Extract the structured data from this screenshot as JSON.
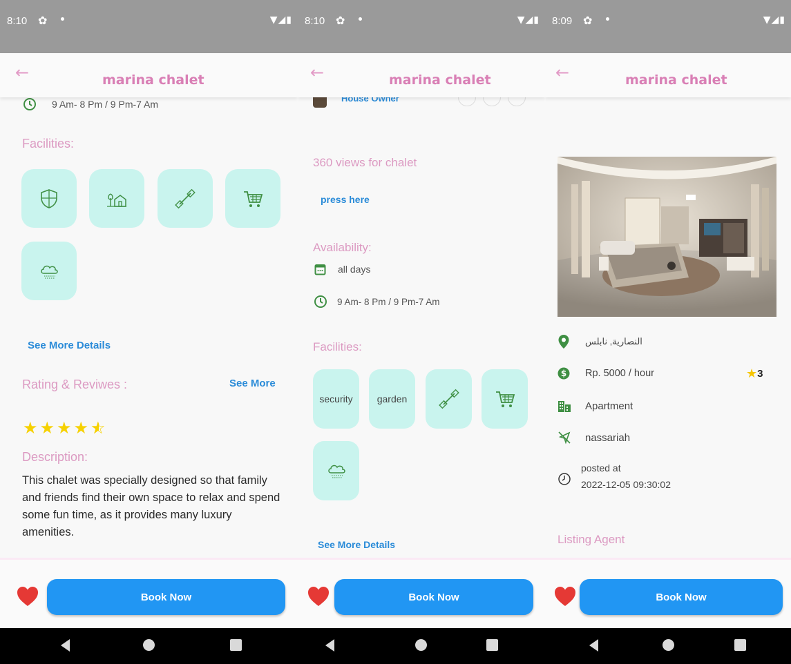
{
  "status": {
    "s1_time": "8:10",
    "s2_time": "8:10",
    "s3_time": "8:09"
  },
  "appbar_title": "marina chalet",
  "screen1": {
    "hours": "9 Am- 8 Pm / 9 Pm-7 Am",
    "facilities_heading": "Facilities:",
    "see_more_details": "See More Details",
    "rating_heading": "Rating & Reviwes :",
    "see_more": "See More",
    "rating_stars": 4.5,
    "description_heading": "Description:",
    "description": "This chalet was specially designed so that family and friends find their own space to relax and spend some fun time, as it provides many luxury amenities."
  },
  "screen2": {
    "owner_label": "House Owner",
    "views_heading": "360 views for chalet",
    "press_here": "press here",
    "availability_heading": "Availability:",
    "days": "all days",
    "hours": "9 Am- 8 Pm / 9 Pm-7 Am",
    "facilities_heading": "Facilities:",
    "facility_security": "security",
    "facility_garden": "garden",
    "see_more_details": "See More Details"
  },
  "screen3": {
    "location": "النصارية, نابلس",
    "price": "Rp. 5000 / hour",
    "rating": "3",
    "type": "Apartment",
    "area": "nassariah",
    "posted_label": "posted at",
    "posted_date": "2022-12-05 09:30:02",
    "listing_agent": "Listing Agent"
  },
  "book_now": "Book Now",
  "colors": {
    "accent_pink": "#d97fb5",
    "primary_blue": "#2196f3",
    "facility_bg": "#c9f4ee",
    "icon_green": "#3f8f43"
  }
}
